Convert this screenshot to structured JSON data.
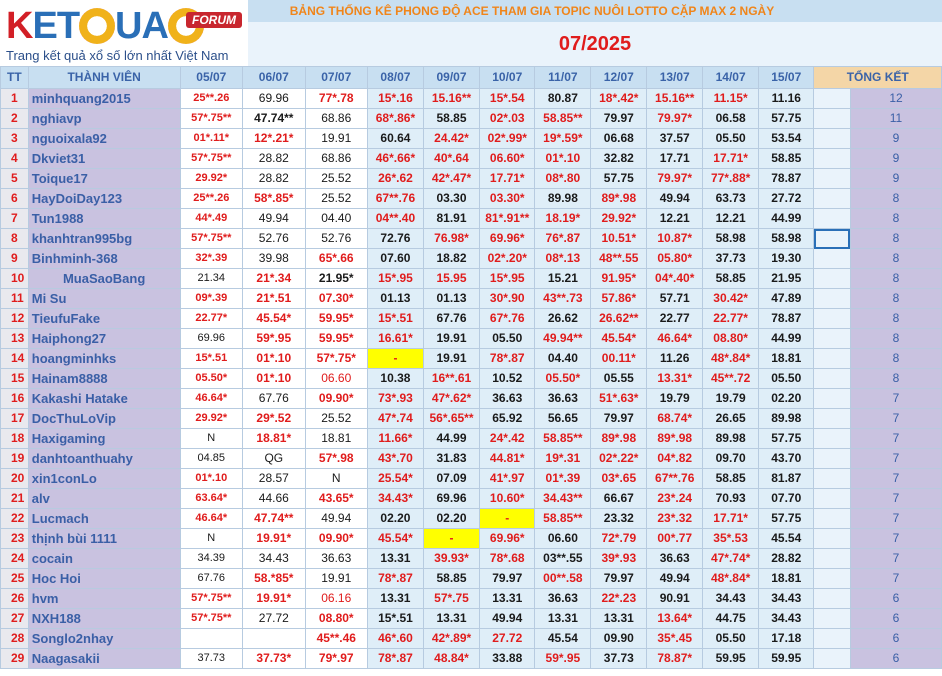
{
  "logo": {
    "forum": "FORUM",
    "tagline": "Trang kết quả xổ số lớn nhất Việt Nam",
    "brand": "KETQUA2"
  },
  "title": "BẢNG THỐNG KÊ PHONG ĐỘ ACE THAM GIA TOPIC NUÔI LOTTO CẶP MAX 2 NGÀY",
  "month": "07/2025",
  "headers": {
    "tt": "TT",
    "member": "THÀNH VIÊN",
    "total": "TỔNG KẾT",
    "dates": [
      "05/07",
      "06/07",
      "07/07",
      "08/07",
      "09/07",
      "10/07",
      "11/07",
      "12/07",
      "13/07",
      "14/07",
      "15/07"
    ]
  },
  "rows": [
    {
      "tt": "1",
      "name": "minhquang2015",
      "vals": [
        "25**.26",
        "69.96",
        "77*.78",
        "15*.16",
        "15.16**",
        "15*.54",
        "80.87",
        "18*.42*",
        "15.16**",
        "11.15*",
        "11.16"
      ],
      "total": "12"
    },
    {
      "tt": "2",
      "name": "nghiavp",
      "vals": [
        "57*.75**",
        "47.74**",
        "68.86",
        "68*.86*",
        "58.85",
        "02*.03",
        "58.85**",
        "79.97",
        "79.97*",
        "06.58",
        "57.75"
      ],
      "total": "11"
    },
    {
      "tt": "3",
      "name": "nguoixala92",
      "vals": [
        "01*.11*",
        "12*.21*",
        "19.91",
        "60.64",
        "24.42*",
        "02*.99*",
        "19*.59*",
        "06.68",
        "37.57",
        "05.50",
        "53.54"
      ],
      "total": "9"
    },
    {
      "tt": "4",
      "name": "Dkviet31",
      "vals": [
        "57*.75**",
        "28.82",
        "68.86",
        "46*.66*",
        "40*.64",
        "06.60*",
        "01*.10",
        "32.82",
        "17.71",
        "17.71*",
        "58.85"
      ],
      "total": "9"
    },
    {
      "tt": "5",
      "name": "Toique17",
      "vals": [
        "29.92*",
        "28.82",
        "25.52",
        "26*.62",
        "42*.47*",
        "17.71*",
        "08*.80",
        "57.75",
        "79.97*",
        "77*.88*",
        "78.87"
      ],
      "total": "9"
    },
    {
      "tt": "6",
      "name": "HayDoiDay123",
      "vals": [
        "25**.26",
        "58*.85*",
        "25.52",
        "67**.76",
        "03.30",
        "03.30*",
        "89.98",
        "89*.98",
        "49.94",
        "63.73",
        "27.72"
      ],
      "total": "8"
    },
    {
      "tt": "7",
      "name": "Tun1988",
      "vals": [
        "44*.49",
        "49.94",
        "04.40",
        "04**.40",
        "81.91",
        "81*.91**",
        "18.19*",
        "29.92*",
        "12.21",
        "12.21",
        "44.99"
      ],
      "total": "8"
    },
    {
      "tt": "8",
      "name": "khanhtran995bg",
      "vals": [
        "57*.75**",
        "52.76",
        "52.76",
        "72.76",
        "76.98*",
        "69.96*",
        "76*.87",
        "10.51*",
        "10.87*",
        "58.98",
        "58.98"
      ],
      "total": "8"
    },
    {
      "tt": "9",
      "name": "Binhminh-368",
      "vals": [
        "32*.39",
        "39.98",
        "65*.66",
        "07.60",
        "18.82",
        "02*.20*",
        "08*.13",
        "48**.55",
        "05.80*",
        "37.73",
        "19.30"
      ],
      "total": "8"
    },
    {
      "tt": "10",
      "name": "MuaSaoBang",
      "vals": [
        "21.34",
        "21*.34",
        "21.95*",
        "15*.95",
        "15.95",
        "15*.95",
        "15.21",
        "91.95*",
        "04*.40*",
        "58.85",
        "21.95"
      ],
      "total": "8"
    },
    {
      "tt": "11",
      "name": "Mi Su",
      "vals": [
        "09*.39",
        "21*.51",
        "07.30*",
        "01.13",
        "01.13",
        "30*.90",
        "43**.73",
        "57.86*",
        "57.71",
        "30.42*",
        "47.89"
      ],
      "total": "8"
    },
    {
      "tt": "12",
      "name": "TieufuFake",
      "vals": [
        "22.77*",
        "45.54*",
        "59.95*",
        "15*.51",
        "67.76",
        "67*.76",
        "26.62",
        "26.62**",
        "22.77",
        "22.77*",
        "78.87"
      ],
      "total": "8"
    },
    {
      "tt": "13",
      "name": "Haiphong27",
      "vals": [
        "69.96",
        "59*.95",
        "59.95*",
        "16.61*",
        "19.91",
        "05.50",
        "49.94**",
        "45.54*",
        "46.64*",
        "08.80*",
        "44.99"
      ],
      "total": "8"
    },
    {
      "tt": "14",
      "name": "hoangminhks",
      "vals": [
        "15*.51",
        "01*.10",
        "57*.75*",
        "-",
        "19.91",
        "78*.87",
        "04.40",
        "00.11*",
        "11.26",
        "48*.84*",
        "18.81"
      ],
      "total": "8"
    },
    {
      "tt": "15",
      "name": "Hainam8888",
      "vals": [
        "05.50*",
        "01*.10",
        "06.60",
        "10.38",
        "16**.61",
        "10.52",
        "05.50*",
        "05.55",
        "13.31*",
        "45**.72",
        "05.50"
      ],
      "total": "8"
    },
    {
      "tt": "16",
      "name": "Kakashi Hatake",
      "vals": [
        "46.64*",
        "67.76",
        "09.90*",
        "73*.93",
        "47*.62*",
        "36.63",
        "36.63",
        "51*.63*",
        "19.79",
        "19.79",
        "02.20"
      ],
      "total": "7"
    },
    {
      "tt": "17",
      "name": "DocThuLoVip",
      "vals": [
        "29.92*",
        "29*.52",
        "25.52",
        "47*.74",
        "56*.65**",
        "65.92",
        "56.65",
        "79.97",
        "68.74*",
        "26.65",
        "89.98"
      ],
      "total": "7"
    },
    {
      "tt": "18",
      "name": "Haxigaming",
      "vals": [
        "N",
        "18.81*",
        "18.81",
        "11.66*",
        "44.99",
        "24*.42",
        "58.85**",
        "89*.98",
        "89*.98",
        "89.98",
        "57.75"
      ],
      "total": "7"
    },
    {
      "tt": "19",
      "name": "danhtoanthuahy",
      "vals": [
        "04.85",
        "QG",
        "57*.98",
        "43*.70",
        "31.83",
        "44.81*",
        "19*.31",
        "02*.22*",
        "04*.82",
        "09.70",
        "43.70"
      ],
      "total": "7"
    },
    {
      "tt": "20",
      "name": "xin1conLo",
      "vals": [
        "01*.10",
        "28.57",
        "N",
        "25.54*",
        "07.09",
        "41*.97",
        "01*.39",
        "03*.65",
        "67**.76",
        "58.85",
        "81.87"
      ],
      "total": "7"
    },
    {
      "tt": "21",
      "name": "alv",
      "vals": [
        "63.64*",
        "44.66",
        "43.65*",
        "34.43*",
        "69.96",
        "10.60*",
        "34.43**",
        "66.67",
        "23*.24",
        "70.93",
        "07.70"
      ],
      "total": "7"
    },
    {
      "tt": "22",
      "name": "Lucmach",
      "vals": [
        "46.64*",
        "47.74**",
        "49.94",
        "02.20",
        "02.20",
        "-",
        "58.85**",
        "23.32",
        "23*.32",
        "17.71*",
        "57.75"
      ],
      "total": "7"
    },
    {
      "tt": "23",
      "name": "thịnh bùi 1111",
      "vals": [
        "N",
        "19.91*",
        "09.90*",
        "45.54*",
        "-",
        "69.96*",
        "06.60",
        "72*.79",
        "00*.77",
        "35*.53",
        "45.54"
      ],
      "total": "7"
    },
    {
      "tt": "24",
      "name": "cocain",
      "vals": [
        "34.39",
        "34.43",
        "36.63",
        "13.31",
        "39.93*",
        "78*.68",
        "03**.55",
        "39*.93",
        "36.63",
        "47*.74*",
        "28.82"
      ],
      "total": "7"
    },
    {
      "tt": "25",
      "name": "Hoc Hoi",
      "vals": [
        "67.76",
        "58.*85*",
        "19.91",
        "78*.87",
        "58.85",
        "79.97",
        "00**.58",
        "79.97",
        "49.94",
        "48*.84*",
        "18.81"
      ],
      "total": "7"
    },
    {
      "tt": "26",
      "name": "hvm",
      "vals": [
        "57*.75**",
        "19.91*",
        "06.16",
        "13.31",
        "57*.75",
        "13.31",
        "36.63",
        "22*.23",
        "90.91",
        "34.43",
        "34.43"
      ],
      "total": "6"
    },
    {
      "tt": "27",
      "name": "NXH188",
      "vals": [
        "57*.75**",
        "27.72",
        "08.80*",
        "15*.51",
        "13.31",
        "49.94",
        "13.31",
        "13.31",
        "13.64*",
        "44.75",
        "34.43"
      ],
      "total": "6"
    },
    {
      "tt": "28",
      "name": "Songlo2nhay",
      "vals": [
        "",
        "",
        "45**.46",
        "46*.60",
        "42*.89*",
        "27.72",
        "45.54",
        "09.90",
        "35*.45",
        "05.50",
        "17.18"
      ],
      "total": "6"
    },
    {
      "tt": "29",
      "name": "Naagasakii",
      "vals": [
        "37.73",
        "37.73*",
        "79*.97",
        "78*.87",
        "48.84*",
        "33.88",
        "59*.95",
        "37.73",
        "78.87*",
        "59.95",
        "59.95"
      ],
      "total": "6"
    }
  ]
}
